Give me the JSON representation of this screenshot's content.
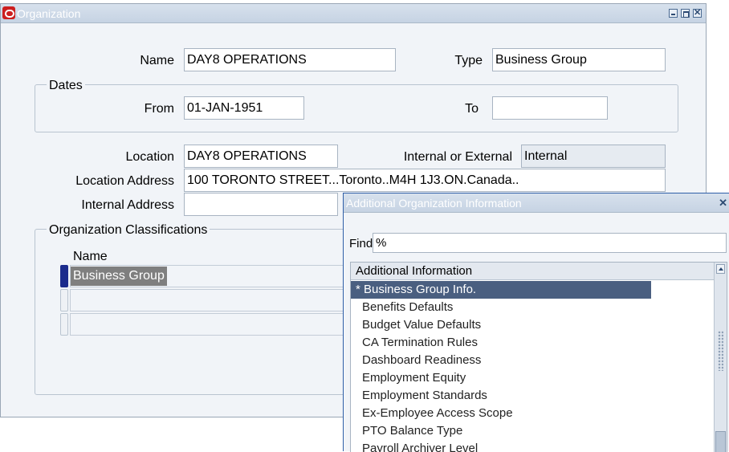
{
  "window": {
    "title": "Organization"
  },
  "form": {
    "name_label": "Name",
    "name_value": "DAY8 OPERATIONS",
    "type_label": "Type",
    "type_value": "Business Group",
    "dates_group_label": "Dates",
    "from_label": "From",
    "from_value": "01-JAN-1951",
    "to_label": "To",
    "to_value": "",
    "location_label": "Location",
    "location_value": "DAY8 OPERATIONS",
    "int_ext_label": "Internal or External",
    "int_ext_value": "Internal",
    "location_address_label": "Location Address",
    "location_address_value": "100 TORONTO STREET...Toronto..M4H 1J3.ON.Canada..",
    "internal_address_label": "Internal Address",
    "internal_address_value": ""
  },
  "classifications": {
    "group_label": "Organization Classifications",
    "column_name": "Name",
    "rows": [
      "Business Group",
      "",
      ""
    ]
  },
  "popup": {
    "title": "Additional Organization Information",
    "find_label": "Find",
    "find_value": "%",
    "list_header": "Additional Information",
    "items": [
      "* Business Group Info.",
      "Benefits Defaults",
      "Budget Value Defaults",
      "CA Termination Rules",
      "Dashboard Readiness",
      "Employment Equity",
      "Employment Standards",
      "Ex-Employee Access Scope",
      "PTO Balance Type",
      "Payroll Archiver Level"
    ],
    "selected_index": 0
  },
  "colors": {
    "selection": "#4a5f80",
    "row_marker": "#1b2b8c",
    "oracle_red": "#cc1f1f"
  }
}
